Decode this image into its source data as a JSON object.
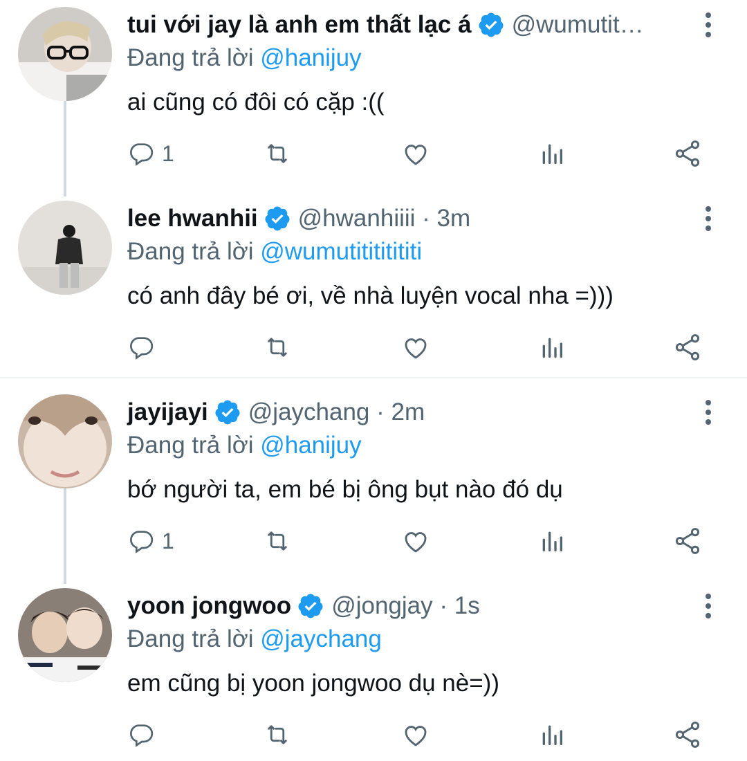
{
  "colors": {
    "accent": "#1d9bf0",
    "secondary_text": "#536471",
    "primary_text": "#0f1419",
    "thread_line": "#cfd9de"
  },
  "icons": {
    "verified": "verified-badge-icon",
    "more": "more-vertical-icon",
    "reply": "reply-icon",
    "retweet": "retweet-icon",
    "like": "like-icon",
    "analytics": "analytics-icon",
    "share": "share-icon"
  },
  "tweets": [
    {
      "name": "tui với jay là anh em thất lạc á",
      "handle": "@wumutit…",
      "reply_prefix": "Đang trả lời ",
      "reply_to": "@hanijuy",
      "text": "ai cũng có đôi có cặp :((",
      "reply_count": "1"
    },
    {
      "name": "lee hwanhii",
      "handle": "@hwanhiiii · 3m",
      "reply_prefix": "Đang trả lời ",
      "reply_to": "@wumutitititititi",
      "text": "có anh đây bé ơi, về nhà luyện vocal nha =)))",
      "reply_count": ""
    },
    {
      "name": "jayijayi",
      "handle": "@jaychang · 2m",
      "reply_prefix": "Đang trả lời ",
      "reply_to": "@hanijuy",
      "text": "bớ người ta, em bé bị ông bụt nào đó dụ",
      "reply_count": "1"
    },
    {
      "name": "yoon jongwoo",
      "handle": "@jongjay · 1s",
      "reply_prefix": "Đang trả lời ",
      "reply_to": "@jaychang",
      "text": "em cũng bị yoon jongwoo dụ nè=))",
      "reply_count": ""
    }
  ]
}
